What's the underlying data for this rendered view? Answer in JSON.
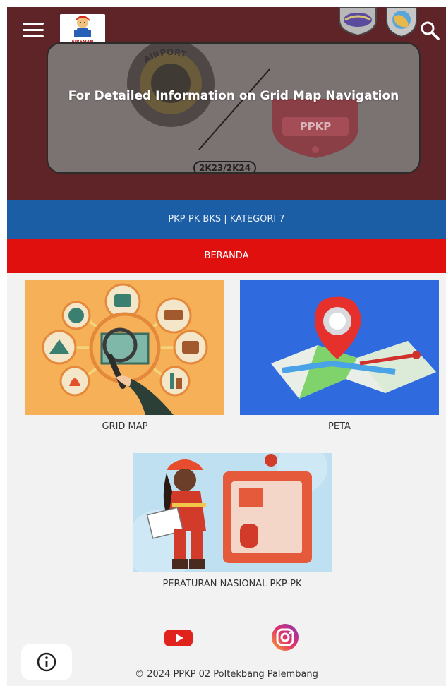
{
  "header": {
    "logo_text": "FIREMAN",
    "menu_icon": "hamburger-menu-icon",
    "search_icon": "search-icon"
  },
  "banner": {
    "title": "For Detailed Information on Grid Map Navigation",
    "code": "2K23/2K24",
    "badge_airport_text": "AIRPORT",
    "badge_ppkp_text": "PPKP"
  },
  "unit_band": {
    "label": "PKP-PK BKS | KATEGORI 7"
  },
  "nav": {
    "home_label": "BERANDA"
  },
  "cards": [
    {
      "label": "GRID MAP"
    },
    {
      "label": "PETA"
    },
    {
      "label": "PERATURAN NASIONAL PKP-PK"
    }
  ],
  "social": {
    "youtube_icon": "youtube-icon",
    "instagram_icon": "instagram-icon"
  },
  "footer": {
    "copyright": "© 2024 PPKP 02 Poltekbang Palembang"
  },
  "colors": {
    "hero_bg": "#5e2428",
    "band_blue": "#1c5ea6",
    "band_red": "#e0100f",
    "page_bg": "#f2f2f2"
  }
}
